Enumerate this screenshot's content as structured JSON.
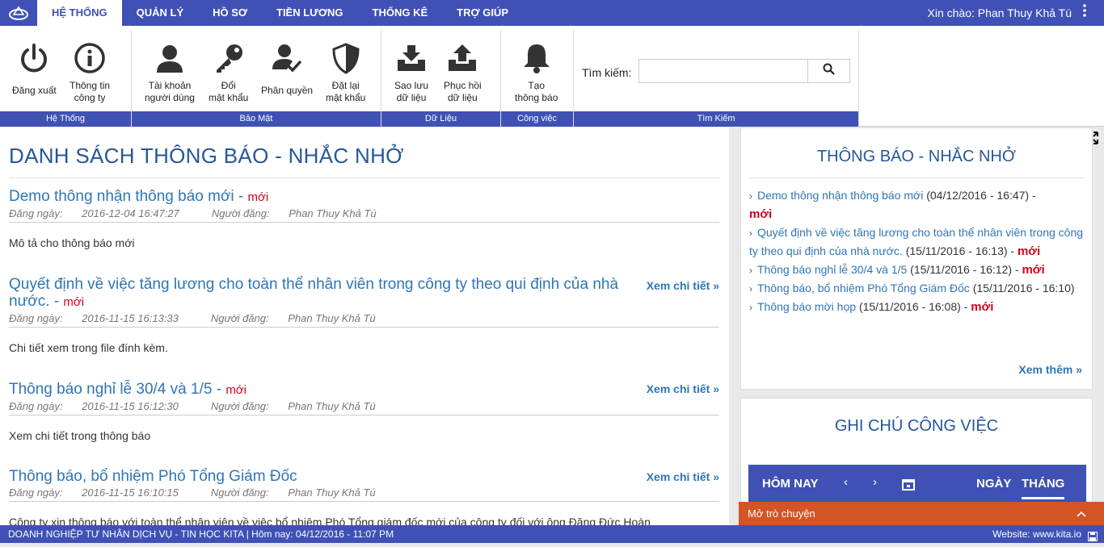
{
  "nav": {
    "tabs": [
      "HỆ THỐNG",
      "QUẢN LÝ",
      "HỒ SƠ",
      "TIỀN LƯƠNG",
      "THỐNG KÊ",
      "TRỢ GIÚP"
    ],
    "greeting": "Xin chào: Phan Thuy Khả Tú"
  },
  "ribbon": {
    "groups": [
      "Hệ Thống",
      "Bảo Mật",
      "Dữ Liệu",
      "Công việc",
      "Tìm Kiếm"
    ],
    "buttons": {
      "logout": "Đăng xuất",
      "company_info": "Thông tin\ncông ty",
      "user_accounts": "Tài khoản\nngười dùng",
      "change_password": "Đổi\nmật khẩu",
      "permissions": "Phân quyền",
      "reset_password": "Đặt lại\nmật khẩu",
      "backup": "Sao lưu\ndữ liệu",
      "restore": "Phục hồi\ndữ liệu",
      "create_notice": "Tạo\nthông báo"
    },
    "search_label": "Tìm kiếm:",
    "search_value": ""
  },
  "main": {
    "title": "DANH SÁCH THÔNG BÁO - NHẮC NHỞ",
    "new_label": "mới",
    "more_label": "Xem chi tiết",
    "posted_prefix": "Đăng ngày:",
    "author_prefix": "Người đăng:",
    "items": [
      {
        "title": "Demo thông nhận thông báo mới",
        "date": "2016-12-04 16:47:27",
        "author": "Phan Thuy Khả Tú",
        "desc": "Mô tả cho thông báo mới",
        "is_new": true,
        "has_more": false
      },
      {
        "title": "Quyết định về việc tăng lương cho toàn thể nhân viên trong công ty theo qui định của nhà nước.",
        "date": "2016-11-15 16:13:33",
        "author": "Phan Thuy Khả Tú",
        "desc": "Chi tiết xem trong file đính kèm.",
        "is_new": true,
        "has_more": true
      },
      {
        "title": "Thông báo nghỉ lễ 30/4 và 1/5",
        "date": "2016-11-15 16:12:30",
        "author": "Phan Thuy Khả Tú",
        "desc": "Xem chi tiết trong thông báo",
        "is_new": true,
        "has_more": true
      },
      {
        "title": "Thông báo, bổ nhiệm Phó Tổng Giám Đốc",
        "date": "2016-11-15 16:10:15",
        "author": "Phan Thuy Khả Tú",
        "desc": "Công ty xin thông báo với toàn thể nhân viên về việc bổ nhiệm Phó Tổng giám đốc mới của công ty đối với ông Đặng Đức Hoàn",
        "is_new": false,
        "has_more": true
      }
    ]
  },
  "side": {
    "notice_title": "THÔNG BÁO - NHẮC NHỞ",
    "notices": [
      {
        "title": "Demo thông nhận thông báo mới",
        "time": "(04/12/2016 - 16:47) -"
      },
      {
        "title": "Quyết định về việc tăng lương cho toàn thể nhân viên trong công ty theo qui định của nhà nước.",
        "time": "(15/11/2016 - 16:13) -"
      },
      {
        "title": "Thông báo nghỉ lễ 30/4 và 1/5",
        "time": "(15/11/2016 - 16:12) -"
      },
      {
        "title": "Thông báo, bổ nhiệm Phó Tổng Giám Đốc",
        "time": "(15/11/2016 - 16:10)"
      },
      {
        "title": "Thông báo mời họp",
        "time": "(15/11/2016 - 16:08) -"
      }
    ],
    "new_label": "mới",
    "see_more": "Xem thêm",
    "task_title": "GHI CHÚ CÔNG VIỆC",
    "cal_today": "HÔM NAY",
    "cal_day": "NGÀY",
    "cal_month": "THÁNG"
  },
  "chat": "Mở trò chuyện",
  "footer": {
    "left": "DOANH NGHIỆP TƯ NHÂN DỊCH VỤ - TIN HỌC KITA | Hôm nay: 04/12/2016 - 11:07 PM",
    "right": "Website: www.kita.io"
  },
  "colors": {
    "primary": "#3f51b5",
    "link": "#2e75b6",
    "new": "#d0021b",
    "chat": "#d35424"
  }
}
